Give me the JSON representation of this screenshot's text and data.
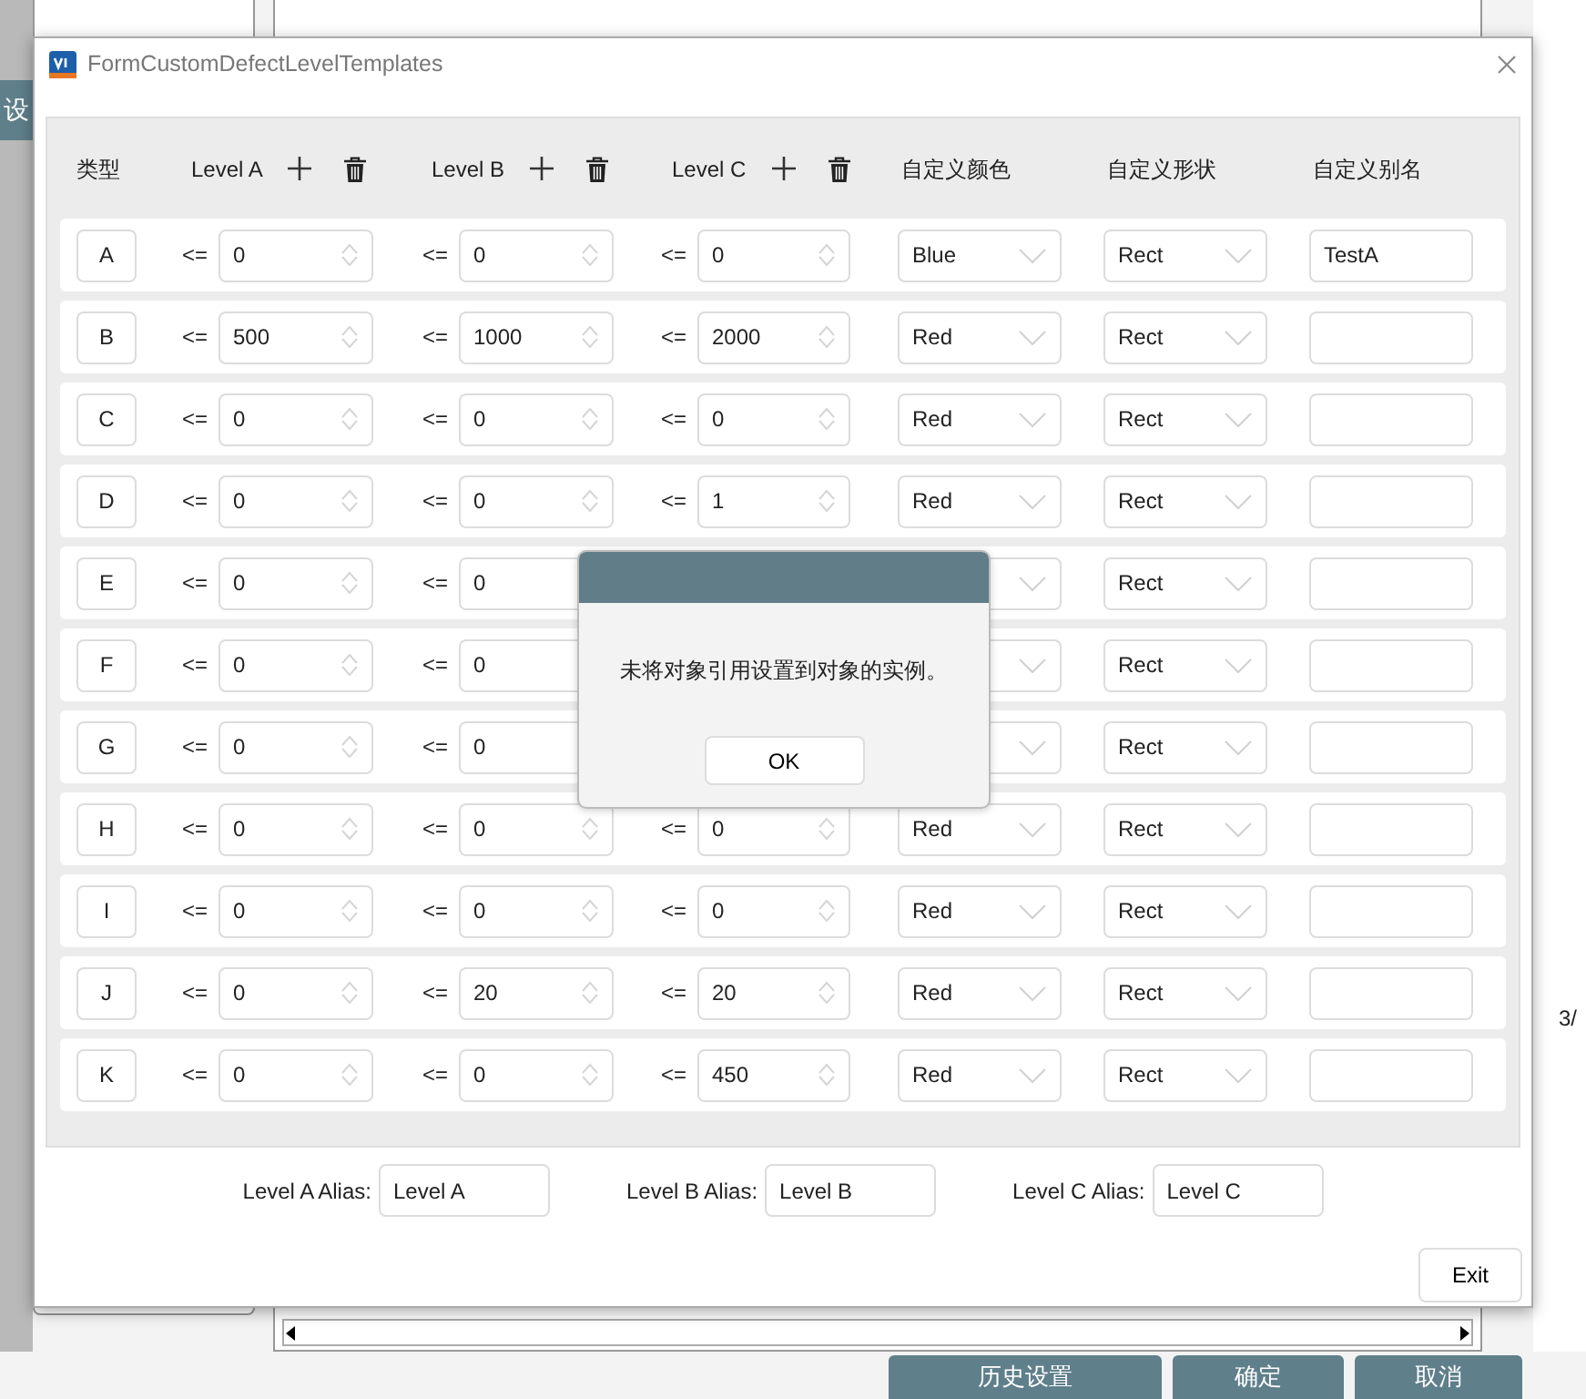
{
  "background": {
    "side_tab": "设",
    "page_indicator": "3/",
    "buttons": [
      "历史设置",
      "确定",
      "取消"
    ]
  },
  "window": {
    "title": "FormCustomDefectLevelTemplates"
  },
  "columns": [
    {
      "label": "类型",
      "kind": "text"
    },
    {
      "label": "Level A",
      "kind": "level"
    },
    {
      "label": "Level B",
      "kind": "level"
    },
    {
      "label": "Level C",
      "kind": "level"
    },
    {
      "label": "自定义颜色",
      "kind": "text"
    },
    {
      "label": "自定义形状",
      "kind": "text"
    },
    {
      "label": "自定义别名",
      "kind": "text"
    }
  ],
  "rows": [
    {
      "type": "A",
      "levels": [
        {
          "op": "<=",
          "value": "0"
        },
        {
          "op": "<=",
          "value": "0"
        },
        {
          "op": "<=",
          "value": "0"
        }
      ],
      "color_name": "Blue",
      "shape": "Rect",
      "alias": "TestA"
    },
    {
      "type": "B",
      "levels": [
        {
          "op": "<=",
          "value": "500"
        },
        {
          "op": "<=",
          "value": "1000"
        },
        {
          "op": "<=",
          "value": "2000"
        }
      ],
      "color_name": "Red",
      "shape": "Rect"
    },
    {
      "type": "C",
      "levels": [
        {
          "op": "<=",
          "value": "0"
        },
        {
          "op": "<=",
          "value": "0"
        },
        {
          "op": "<=",
          "value": "0"
        }
      ],
      "color_name": "Red",
      "shape": "Rect"
    },
    {
      "type": "D",
      "levels": [
        {
          "op": "<=",
          "value": "0"
        },
        {
          "op": "<=",
          "value": "0"
        },
        {
          "op": "<=",
          "value": "1"
        }
      ],
      "color_name": "Red",
      "shape": "Rect"
    },
    {
      "type": "E",
      "levels": [
        {
          "op": "<=",
          "value": "0"
        },
        {
          "op": "<=",
          "value": "0"
        }
      ],
      "shape": "Rect"
    },
    {
      "type": "F",
      "levels": [
        {
          "op": "<=",
          "value": "0"
        },
        {
          "op": "<=",
          "value": "0"
        }
      ],
      "shape": "Rect"
    },
    {
      "type": "G",
      "levels": [
        {
          "op": "<=",
          "value": "0"
        },
        {
          "op": "<=",
          "value": "0"
        }
      ],
      "shape": "Rect"
    },
    {
      "type": "H",
      "levels": [
        {
          "op": "<=",
          "value": "0"
        },
        {
          "op": "<=",
          "value": "0"
        },
        {
          "op": "<=",
          "value": "0"
        }
      ],
      "color_name": "Red",
      "shape": "Rect"
    },
    {
      "type": "I",
      "levels": [
        {
          "op": "<=",
          "value": "0"
        },
        {
          "op": "<=",
          "value": "0"
        },
        {
          "op": "<=",
          "value": "0"
        }
      ],
      "color_name": "Red",
      "shape": "Rect"
    },
    {
      "type": "J",
      "levels": [
        {
          "op": "<=",
          "value": "0"
        },
        {
          "op": "<=",
          "value": "20"
        },
        {
          "op": "<=",
          "value": "20"
        }
      ],
      "color_name": "Red",
      "shape": "Rect"
    },
    {
      "type": "K",
      "levels": [
        {
          "op": "<=",
          "value": "0"
        },
        {
          "op": "<=",
          "value": "0"
        },
        {
          "op": "<=",
          "value": "450"
        }
      ],
      "color_name": "Red",
      "shape": "Rect"
    }
  ],
  "aliases": [
    {
      "label": "Level A Alias:",
      "value": "Level A"
    },
    {
      "label": "Level B Alias:",
      "value": "Level B"
    },
    {
      "label": "Level C Alias:",
      "value": "Level C"
    }
  ],
  "exit_button": "Exit",
  "message_box": {
    "message": "未将对象引用设置到对象的实例。",
    "button": "OK"
  }
}
